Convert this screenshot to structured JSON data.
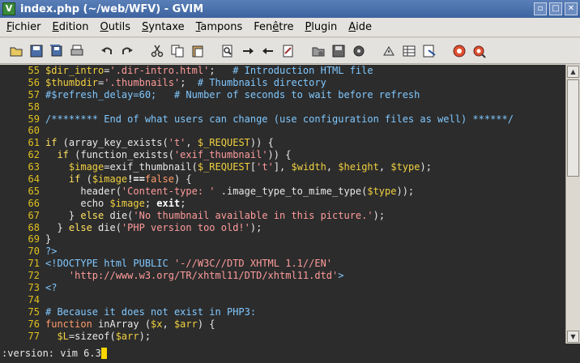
{
  "window": {
    "title": "index.php (~/web/WFV) - GVIM",
    "app_icon_letter": "V",
    "buttons": {
      "minimize": "▫",
      "maximize": "□",
      "close": "✕"
    }
  },
  "menu": [
    {
      "pre": "",
      "u": "F",
      "post": "ichier"
    },
    {
      "pre": "",
      "u": "E",
      "post": "dition"
    },
    {
      "pre": "",
      "u": "O",
      "post": "utils"
    },
    {
      "pre": "",
      "u": "S",
      "post": "yntaxe"
    },
    {
      "pre": "",
      "u": "T",
      "post": "ampons"
    },
    {
      "pre": "Fen",
      "u": "ê",
      "post": "tre"
    },
    {
      "pre": "",
      "u": "P",
      "post": "lugin"
    },
    {
      "pre": "",
      "u": "A",
      "post": "ide"
    }
  ],
  "toolbar_icons": [
    "open-icon",
    "save-icon",
    "save-all-icon",
    "print-icon",
    "|",
    "undo-icon",
    "redo-icon",
    "|",
    "cut-icon",
    "copy-icon",
    "paste-icon",
    "|",
    "find-icon",
    "find-next-icon",
    "find-prev-icon",
    "replace-icon",
    "|",
    "load-session-icon",
    "save-session-icon",
    "run-script-icon",
    "|",
    "make-icon",
    "tags-icon",
    "jump-tag-icon",
    "|",
    "help-icon",
    "find-help-icon"
  ],
  "lines": [
    {
      "n": "55",
      "segs": [
        [
          "var",
          "$dir_intro"
        ],
        [
          "plain",
          "="
        ],
        [
          "str",
          "'.dir-intro.html'"
        ],
        [
          "plain",
          ";   "
        ],
        [
          "com",
          "# Introduction HTML file"
        ]
      ]
    },
    {
      "n": "56",
      "segs": [
        [
          "var",
          "$thumbdir"
        ],
        [
          "plain",
          "="
        ],
        [
          "str",
          "'.thumbnails'"
        ],
        [
          "plain",
          ";  "
        ],
        [
          "com",
          "# Thumbnails directory"
        ]
      ]
    },
    {
      "n": "57",
      "segs": [
        [
          "com",
          "#$refresh_delay=60;   # Number of seconds to wait before refresh"
        ]
      ]
    },
    {
      "n": "58",
      "segs": []
    },
    {
      "n": "59",
      "segs": [
        [
          "com",
          "/******** End of what users can change (use configuration files as well) ******/"
        ]
      ]
    },
    {
      "n": "60",
      "segs": []
    },
    {
      "n": "61",
      "segs": [
        [
          "kw",
          "if"
        ],
        [
          "plain",
          " (array_key_exists("
        ],
        [
          "str",
          "'t'"
        ],
        [
          "plain",
          ", "
        ],
        [
          "var",
          "$_REQUEST"
        ],
        [
          "plain",
          ")) {"
        ]
      ]
    },
    {
      "n": "62",
      "segs": [
        [
          "plain",
          "  "
        ],
        [
          "kw",
          "if"
        ],
        [
          "plain",
          " (function_exists("
        ],
        [
          "str",
          "'exif_thumbnail'"
        ],
        [
          "plain",
          ")) {"
        ]
      ]
    },
    {
      "n": "63",
      "segs": [
        [
          "plain",
          "    "
        ],
        [
          "var",
          "$image"
        ],
        [
          "plain",
          "=exif_thumbnail("
        ],
        [
          "var",
          "$_REQUEST"
        ],
        [
          "plain",
          "["
        ],
        [
          "str",
          "'t'"
        ],
        [
          "plain",
          "], "
        ],
        [
          "var",
          "$width"
        ],
        [
          "plain",
          ", "
        ],
        [
          "var",
          "$height"
        ],
        [
          "plain",
          ", "
        ],
        [
          "var",
          "$type"
        ],
        [
          "plain",
          ");"
        ]
      ]
    },
    {
      "n": "64",
      "segs": [
        [
          "plain",
          "    "
        ],
        [
          "kw",
          "if"
        ],
        [
          "plain",
          " ("
        ],
        [
          "var",
          "$image"
        ],
        [
          "bold",
          "!=="
        ],
        [
          "kw2",
          "false"
        ],
        [
          "plain",
          ") {"
        ]
      ]
    },
    {
      "n": "65",
      "segs": [
        [
          "plain",
          "      header("
        ],
        [
          "str",
          "'Content-type: '"
        ],
        [
          "plain",
          " .image_type_to_mime_type("
        ],
        [
          "var",
          "$type"
        ],
        [
          "plain",
          "));"
        ]
      ]
    },
    {
      "n": "66",
      "segs": [
        [
          "plain",
          "      echo "
        ],
        [
          "var",
          "$image"
        ],
        [
          "plain",
          "; "
        ],
        [
          "bold",
          "exit"
        ],
        [
          "plain",
          ";"
        ]
      ]
    },
    {
      "n": "67",
      "segs": [
        [
          "plain",
          "    } "
        ],
        [
          "kw",
          "else"
        ],
        [
          "plain",
          " die("
        ],
        [
          "str",
          "'No thumbnail available in this picture.'"
        ],
        [
          "plain",
          ");"
        ]
      ]
    },
    {
      "n": "68",
      "segs": [
        [
          "plain",
          "  } "
        ],
        [
          "kw",
          "else"
        ],
        [
          "plain",
          " die("
        ],
        [
          "str",
          "'PHP version too old!'"
        ],
        [
          "plain",
          ");"
        ]
      ]
    },
    {
      "n": "69",
      "segs": [
        [
          "plain",
          "}"
        ]
      ]
    },
    {
      "n": "70",
      "segs": [
        [
          "tag",
          "?>"
        ]
      ]
    },
    {
      "n": "71",
      "segs": [
        [
          "tag",
          "<!DOCTYPE html PUBLIC "
        ],
        [
          "str",
          "'-//W3C//DTD XHTML 1.1//EN'"
        ]
      ]
    },
    {
      "n": "72",
      "segs": [
        [
          "plain",
          "    "
        ],
        [
          "str",
          "'http://www.w3.org/TR/xhtml11/DTD/xhtml11.dtd'"
        ],
        [
          "tag",
          ">"
        ]
      ]
    },
    {
      "n": "73",
      "segs": [
        [
          "tag",
          "<?"
        ]
      ]
    },
    {
      "n": "74",
      "segs": []
    },
    {
      "n": "75",
      "segs": [
        [
          "com",
          "# Because it does not exist in PHP3:"
        ]
      ]
    },
    {
      "n": "76",
      "segs": [
        [
          "kw2",
          "function"
        ],
        [
          "plain",
          " inArray ("
        ],
        [
          "var",
          "$x"
        ],
        [
          "plain",
          ", "
        ],
        [
          "var",
          "$arr"
        ],
        [
          "plain",
          ") {"
        ]
      ]
    },
    {
      "n": "77",
      "segs": [
        [
          "plain",
          "  "
        ],
        [
          "var",
          "$L"
        ],
        [
          "plain",
          "=sizeof("
        ],
        [
          "var",
          "$arr"
        ],
        [
          "plain",
          ");"
        ]
      ]
    }
  ],
  "command_line": ":version: vim 6.3",
  "colors": {
    "background": "#2c2c2c",
    "line_numbers": "#e0c020",
    "variables": "#f0d040",
    "strings": "#ff9b9b",
    "comments": "#80c8ff",
    "cursor": "#ffd700"
  }
}
